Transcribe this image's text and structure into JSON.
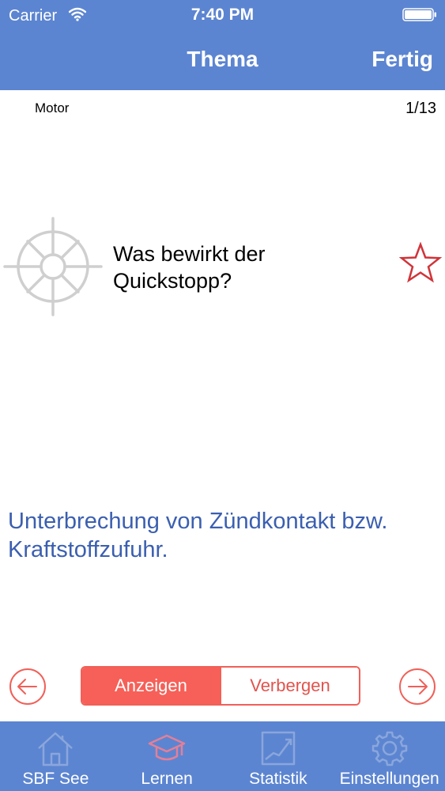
{
  "status_bar": {
    "carrier": "Carrier",
    "time": "7:40 PM"
  },
  "nav": {
    "title": "Thema",
    "done_label": "Fertig"
  },
  "card": {
    "category": "Motor",
    "counter": "1/13",
    "question": "Was bewirkt der Quickstopp?",
    "answer": "Unterbrechung von Zündkontakt bzw. Kraftstoffzufuhr.",
    "favorite_icon": "star-outline-icon",
    "illustration_icon": "ships-wheel-icon"
  },
  "controls": {
    "prev_icon": "arrow-left-icon",
    "next_icon": "arrow-right-icon",
    "segment": {
      "options": [
        "Anzeigen",
        "Verbergen"
      ],
      "selected": "Anzeigen"
    }
  },
  "tabbar": {
    "tabs": [
      {
        "label": "SBF See",
        "icon": "home-icon"
      },
      {
        "label": "Lernen",
        "icon": "graduation-cap-icon",
        "active": true
      },
      {
        "label": "Statistik",
        "icon": "chart-icon"
      },
      {
        "label": "Einstellungen",
        "icon": "gear-icon"
      }
    ]
  },
  "colors": {
    "primary_blue": "#5c85d1",
    "answer_blue": "#3b5fb0",
    "accent_red": "#f66058",
    "star_red": "#d0343a"
  }
}
